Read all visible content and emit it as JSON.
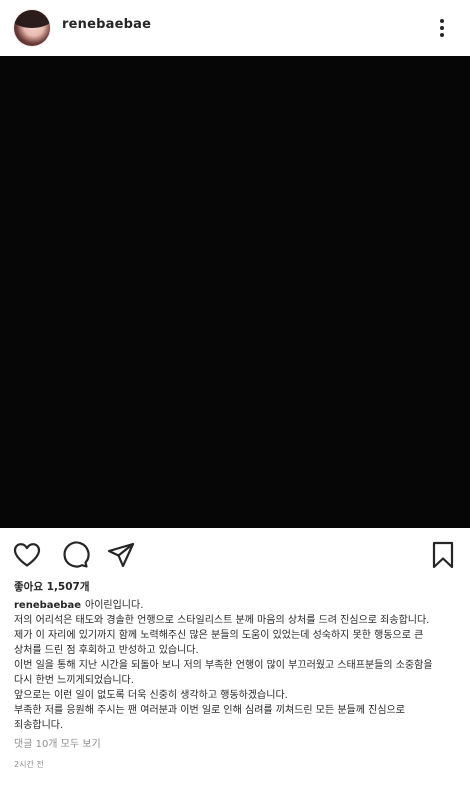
{
  "post": {
    "username": "renebaebae",
    "likes_text": "좋아요 1,507개",
    "caption_first_line": "아이린입니다.",
    "caption_lines": [
      "저의 어리석은 태도와 경솔한 언행으로 스타일리스트 분께 마음의 상처를 드려 진심으로 죄송합니다.",
      "제가 이 자리에 있기까지 함께 노력해주신 많은 분들의 도움이 있었는데 성숙하지 못한 행동으로 큰",
      "상처를 드린 점 후회하고 반성하고 있습니다.",
      "이번 일을 통해 지난 시간을 되돌아 보니 저의 부족한 언행이 많이 부끄러웠고 스태프분들의 소중함을",
      "다시 한번 느끼게되었습니다.",
      "앞으로는 이런 일이 없도록 더욱 신중히 생각하고 행동하겠습니다.",
      "부족한 저를 응원해 주시는 팬 여러분과 이번 일로 인해 심려를 끼쳐드린 모든 분들께 진심으로",
      "죄송합니다."
    ],
    "view_comments": "댓글 10개 모두 보기",
    "timestamp": "2시간 전"
  },
  "icons": {
    "like": "heart-icon",
    "comment": "comment-icon",
    "share": "paper-plane-icon",
    "save": "bookmark-icon",
    "more": "more-vertical-icon"
  },
  "colors": {
    "photo_background": "#060606",
    "text": "#262626",
    "muted_text": "#8e8e8e"
  }
}
